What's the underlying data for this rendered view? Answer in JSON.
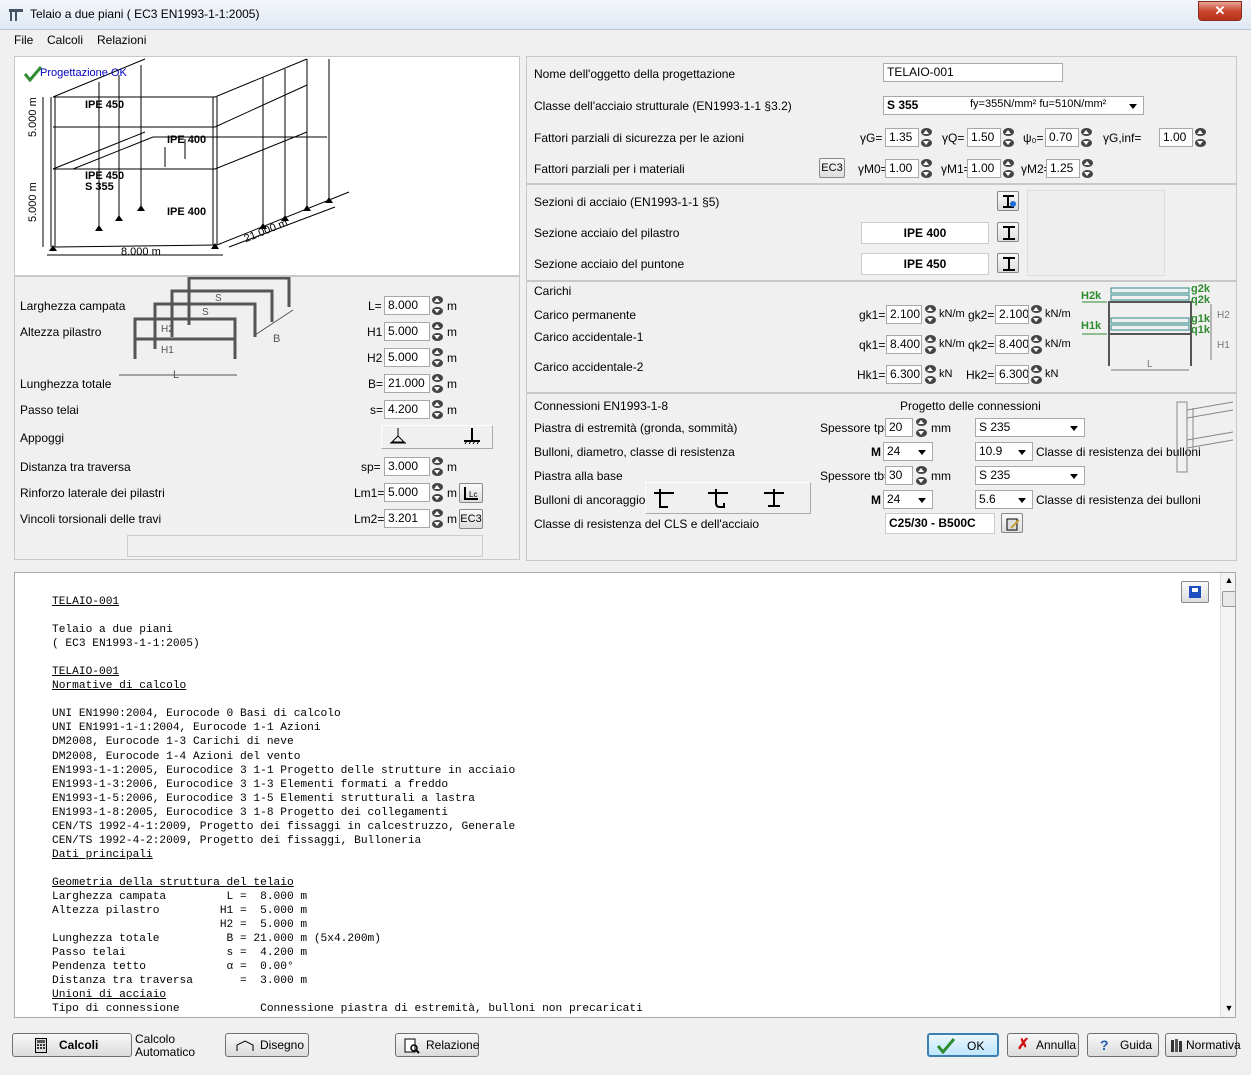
{
  "window": {
    "title": "Telaio a due piani ( EC3 EN1993-1-1:2005)"
  },
  "menu": [
    "File",
    "Calcoli",
    "Relazioni"
  ],
  "diagram": {
    "status": "Progettazione OK",
    "labels": {
      "ipe450a": "IPE 450",
      "ipe400a": "IPE 400",
      "ipe450b": "IPE 450",
      "s355": "S 355",
      "ipe400b": "IPE 400",
      "dim_l": "8.000 m",
      "dim_b": "21.000 m",
      "dim_h1": "5.000 m",
      "dim_h2": "5.000 m"
    }
  },
  "geometry": {
    "larghezza_label": "Larghezza campata",
    "altezza_label": "Altezza pilastro",
    "lunghezza_label": "Lunghezza totale",
    "passo_label": "Passo telai",
    "appoggi_label": "Appoggi",
    "traversa_label": "Distanza tra traversa",
    "rinforzo_label": "Rinforzo laterale dei pilastri",
    "vincoli_label": "Vincoli torsionali delle travi",
    "L_pre": "L=",
    "L": "8.000",
    "H1_pre": "H1",
    "H1": "5.000",
    "H2_pre": "H2",
    "H2": "5.000",
    "B_pre": "B=",
    "B": "21.000",
    "s_pre": "s=",
    "s": "4.200",
    "sp_pre": "sp=",
    "sp": "3.000",
    "Lm1_pre": "Lm1=",
    "Lm1": "5.000",
    "Lm2_pre": "Lm2=",
    "Lm2": "3.201",
    "unit": "m",
    "ec3": "EC3",
    "sketch": {
      "s1": "S",
      "s2": "S",
      "h2": "H2",
      "h1": "H1",
      "b": "B",
      "l": "L"
    }
  },
  "design": {
    "nome_label": "Nome dell'oggetto della progettazione",
    "nome": "TELAIO-001",
    "acciaio_label": "Classe dell'acciaio strutturale (EN1993-1-1 §3.2)",
    "acciaio": "S 355",
    "acciaio_props": "fy=355N/mm² fu=510N/mm²",
    "fattori_azioni_label": "Fattori parziali di sicurezza per le azioni",
    "gG_lbl": "γG=",
    "gG": "1.35",
    "gQ_lbl": "γQ=",
    "gQ": "1.50",
    "psi_lbl": "ψ₀=",
    "psi": "0.70",
    "gGinf_lbl": "γG,inf=",
    "gGinf": "1.00",
    "fattori_mat_label": "Fattori parziali per i materiali",
    "ec3_btn": "EC3",
    "gM0_lbl": "γM0=",
    "gM0": "1.00",
    "gM1_lbl": "γM1=",
    "gM1": "1.00",
    "gM2_lbl": "γM2=",
    "gM2": "1.25",
    "sezioni_label": "Sezioni di acciaio (EN1993-1-1 §5)",
    "pilastro_label": "Sezione acciaio del pilastro",
    "pilastro": "IPE 400",
    "puntone_label": "Sezione acciaio del puntone",
    "puntone": "IPE 450"
  },
  "loads": {
    "title": "Carichi",
    "perm_label": "Carico permanente",
    "acc1_label": "Carico accidentale-1",
    "acc2_label": "Carico accidentale-2",
    "gk1_lbl": "gk1=",
    "gk1": "2.100",
    "gk2_lbl": "gk2=",
    "gk2": "2.100",
    "qk1_lbl": "qk1=",
    "qk1": "8.400",
    "qk2_lbl": "qk2=",
    "qk2": "8.400",
    "Hk1_lbl": "Hk1=",
    "Hk1": "6.300",
    "Hk2_lbl": "Hk2=",
    "Hk2": "6.300",
    "u_knm": "kN/m",
    "u_kn": "kN",
    "sketch": {
      "g2k": "g2k",
      "q2k": "q2k",
      "h2k": "H2k",
      "g1k": "g1k",
      "q1k": "q1k",
      "h1k": "H1k",
      "h2": "H2",
      "h1": "H1",
      "l": "L"
    }
  },
  "connections": {
    "title": "Connessioni  EN1993-1-8",
    "project_label": "Progetto delle connessioni",
    "piastra_label": "Piastra di estremità (gronda, sommità)",
    "tp_lbl": "Spessore tp=",
    "tp": "20",
    "tp_unit": "mm",
    "tp_steel": "S 235",
    "bulloni_label": "Bulloni, diametro, classe di resistenza",
    "m1": "M",
    "d1": "24",
    "cls1": "10.9",
    "cls_label": "Classe di resistenza dei bulloni",
    "base_label": "Piastra alla base",
    "tb_lbl": "Spessore tb=",
    "tb": "30",
    "tb_unit": "mm",
    "tb_steel": "S 235",
    "ancoraggio_label": "Bulloni di ancoraggio",
    "m2": "M",
    "d2": "24",
    "cls2": "5.6",
    "cls2_label": "Classe di resistenza dei bulloni",
    "cls_acc_label": "Classe di resistenza del CLS e dell'acciaio",
    "cls_acc": "C25/30 - B500C"
  },
  "report": {
    "text": "TELAIO-001\n\nTelaio a due piani\n( EC3 EN1993-1-1:2005)\n\nTELAIO-001\nNormative di calcolo\n\nUNI EN1990:2004, Eurocode 0 Basi di calcolo\nUNI EN1991-1-1:2004, Eurocode 1-1 Azioni\nDM2008, Eurocode 1-3 Carichi di neve\nDM2008, Eurocode 1-4 Azioni del vento\nEN1993-1-1:2005, Eurocodice 3 1-1 Progetto delle strutture in acciaio\nEN1993-1-3:2006, Eurocodice 3 1-3 Elementi formati a freddo\nEN1993-1-5:2006, Eurocodice 3 1-5 Elementi strutturali a lastra\nEN1993-1-8:2005, Eurocodice 3 1-8 Progetto dei collegamenti\nCEN/TS 1992-4-1:2009, Progetto dei fissaggi in calcestruzzo, Generale\nCEN/TS 1992-4-2:2009, Progetto dei fissaggi, Bulloneria\nDati principali\n\nGeometria della struttura del telaio\nLarghezza campata         L =  8.000 m\nAltezza pilastro         H1 =  5.000 m\n                         H2 =  5.000 m\nLunghezza totale          B = 21.000 m (5x4.200m)\nPasso telai               s =  4.200 m\nPendenza tetto            α =  0.00°\nDistanza tra traversa       =  3.000 m\nUnioni di acciaio\nTipo di connessione            Connessione piastra di estremità, bulloni non precaricati"
  },
  "bottom": {
    "calcoli": "Calcoli",
    "calcolo_auto": "Calcolo\nAutomatico",
    "disegno": "Disegno",
    "relazione": "Relazione",
    "ok": "OK",
    "annulla": "Annulla",
    "guida": "Guida",
    "normativa": "Normativa"
  },
  "colors": {
    "accent_green": "#2e8b2e",
    "status_blue": "#0000c0"
  }
}
